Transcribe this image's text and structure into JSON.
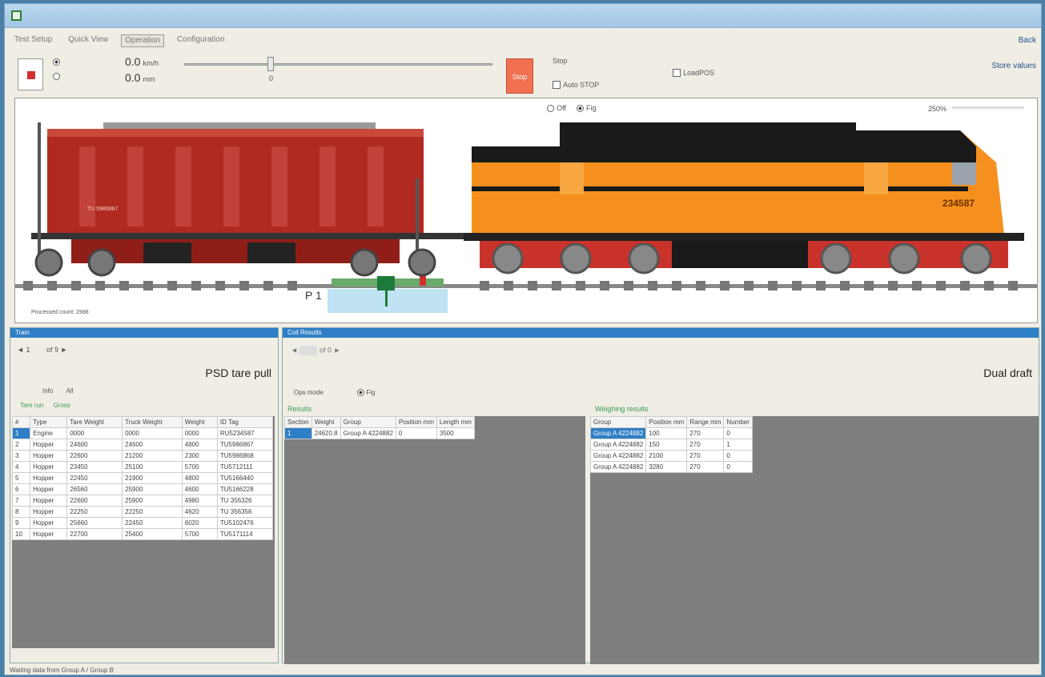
{
  "window": {
    "title": ""
  },
  "menu": {
    "items": [
      "Test Setup",
      "Quick View",
      "Operation",
      "Configuration"
    ],
    "active_index": 2
  },
  "topbar": {
    "right_link_1": "Back",
    "right_link_2": "Store values",
    "speed_value": "0.0",
    "speed_unit": "km/h",
    "position_value": "0.0",
    "position_unit": "mm",
    "slider_tick": "0",
    "stop_label": "Stop",
    "mode_label": "Stop",
    "auto_stop_label": "Auto STOP",
    "loadpos_label": "LoadPOS"
  },
  "scene": {
    "radio_a": "Off",
    "radio_b": "Fig",
    "zoom_value": "250%",
    "loco_number": "234587",
    "wagon_marking": "TU 5986867",
    "sensor_label": "P 1",
    "footer_note": "Processed count: 2988"
  },
  "left_panel": {
    "title": "Train",
    "nav": {
      "page": "1",
      "of": "of 9"
    },
    "heading": "PSD tare pull",
    "info_label": "Info",
    "info_value": "All",
    "tabs": [
      "Tare run",
      "Gross"
    ],
    "columns": [
      "#",
      "Type",
      "Tare Weight",
      "Truck Weight",
      "Weight",
      "ID Tag"
    ],
    "rows": [
      [
        "1",
        "Engine",
        "0000",
        "0000",
        "0000",
        "RU5234587"
      ],
      [
        "2",
        "Hopper",
        "24600",
        "24600",
        "4800",
        "TU5986867"
      ],
      [
        "3",
        "Hopper",
        "22600",
        "21200",
        "2300",
        "TU5986868"
      ],
      [
        "4",
        "Hopper",
        "23450",
        "25100",
        "5700",
        "TU5712111"
      ],
      [
        "5",
        "Hopper",
        "22450",
        "21900",
        "4800",
        "TU5166440"
      ],
      [
        "6",
        "Hopper",
        "26560",
        "25900",
        "4600",
        "TU5166228"
      ],
      [
        "7",
        "Hopper",
        "22600",
        "25900",
        "4980",
        "TU 356326"
      ],
      [
        "8",
        "Hopper",
        "22250",
        "22250",
        "4620",
        "TU 356356"
      ],
      [
        "9",
        "Hopper",
        "25660",
        "22450",
        "6020",
        "TU5102476"
      ],
      [
        "10",
        "Hopper",
        "22700",
        "25400",
        "5700",
        "TU5171114"
      ]
    ]
  },
  "right_panel": {
    "title": "Coil Results",
    "nav_page": "of 0",
    "heading": "Dual draft",
    "ops_label": "Ops mode",
    "ops_radio": "Fig",
    "results_label": "Results",
    "results_columns": [
      "Section",
      "Weight",
      "Group",
      "Position mm",
      "Length mm"
    ],
    "results_rows": [
      [
        "1",
        "24620.8",
        "Group A 4224882",
        "0",
        "3500"
      ]
    ],
    "weighing_label": "Weighing results",
    "weighing_columns": [
      "Group",
      "Position mm",
      "Range mm",
      "Number"
    ],
    "weighing_rows": [
      [
        "Group A 4224882",
        "100",
        "270",
        "0"
      ],
      [
        "Group A 4224882",
        "150",
        "270",
        "1"
      ],
      [
        "Group A 4224882",
        "2100",
        "270",
        "0"
      ],
      [
        "Group A 4224882",
        "3280",
        "270",
        "0"
      ]
    ]
  },
  "status": {
    "text": "Waiting data from Group A / Group B"
  },
  "colors": {
    "accent": "#2f7fc6",
    "wagon": "#b02a22",
    "loco": "#f5901e",
    "stop": "#f07050"
  }
}
